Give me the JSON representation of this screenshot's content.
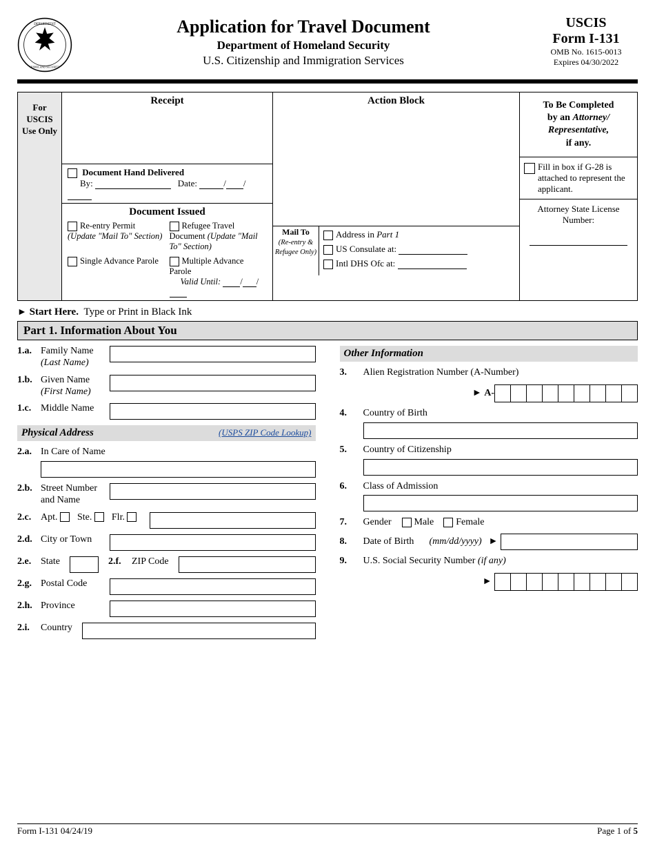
{
  "header": {
    "title": "Application for Travel Document",
    "dept": "Department of Homeland Security",
    "agency": "U.S. Citizenship and Immigration Services",
    "uscis": "USCIS",
    "form_no": "Form I-131",
    "omb": "OMB No. 1615-0013",
    "expires": "Expires 04/30/2022"
  },
  "top": {
    "for_uscis": "For USCIS Use Only",
    "receipt": "Receipt",
    "action_block": "Action Block",
    "doc_hand": "Document Hand Delivered",
    "by": "By:",
    "date": "Date:",
    "doc_issued": "Document Issued",
    "reentry": "Re-entry Permit",
    "reentry_note": "(Update \"Mail To\" Section)",
    "refugee_doc": "Refugee Travel Document",
    "refugee_note": "(Update \"Mail To\" Section)",
    "single_parole": "Single Advance Parole",
    "multi_parole": "Multiple Advance Parole",
    "valid_until": "Valid Until:",
    "mail_to": "Mail To",
    "mail_to_sub": "(Re-entry & Refugee Only)",
    "addr_part1": "Address in Part 1",
    "us_consulate": "US Consulate at:",
    "intl_dhs": "Intl DHS Ofc at:",
    "attorney_title": "To Be Completed by an Attorney/ Representative, if any.",
    "attorney_title_line1": "To Be Completed",
    "attorney_title_line2": "by an",
    "attorney_title_line3": "Attorney/",
    "attorney_title_line4": "Representative,",
    "attorney_title_line5": "if any.",
    "g28": "Fill in box if G-28 is attached to represent the applicant.",
    "attorney_license": "Attorney State License Number:"
  },
  "start_here": "Start Here.",
  "start_here_rest": "Type or Print in Black Ink",
  "part1": "Part 1.  Information About You",
  "fields": {
    "fam_name": "Family Name",
    "last_name": "(Last Name)",
    "given_name": "Given Name",
    "first_name": "(First Name)",
    "middle_name": "Middle Name",
    "phys_addr": "Physical Address",
    "zip_lookup": "(USPS ZIP Code Lookup)",
    "in_care": "In Care of Name",
    "street": "Street Number and Name",
    "apt": "Apt.",
    "ste": "Ste.",
    "flr": "Flr.",
    "city": "City or Town",
    "state": "State",
    "zip": "ZIP Code",
    "postal": "Postal Code",
    "province": "Province",
    "country": "Country",
    "other_info": "Other Information",
    "a_number": "Alien Registration Number (A-Number)",
    "a_prefix": "A-",
    "country_birth": "Country of Birth",
    "country_citizen": "Country of Citizenship",
    "class_admission": "Class of Admission",
    "gender": "Gender",
    "male": "Male",
    "female": "Female",
    "dob": "Date of Birth",
    "dob_fmt": "(mm/dd/yyyy)",
    "ssn": "U.S. Social Security Number (if any)"
  },
  "nums": {
    "n1a": "1.a.",
    "n1b": "1.b.",
    "n1c": "1.c.",
    "n2a": "2.a.",
    "n2b": "2.b.",
    "n2c": "2.c.",
    "n2d": "2.d.",
    "n2e": "2.e.",
    "n2f": "2.f.",
    "n2g": "2.g.",
    "n2h": "2.h.",
    "n2i": "2.i.",
    "n3": "3.",
    "n4": "4.",
    "n5": "5.",
    "n6": "6.",
    "n7": "7.",
    "n8": "8.",
    "n9": "9."
  },
  "footer": {
    "left": "Form I-131   04/24/19",
    "right": "Page 1 of 5"
  }
}
